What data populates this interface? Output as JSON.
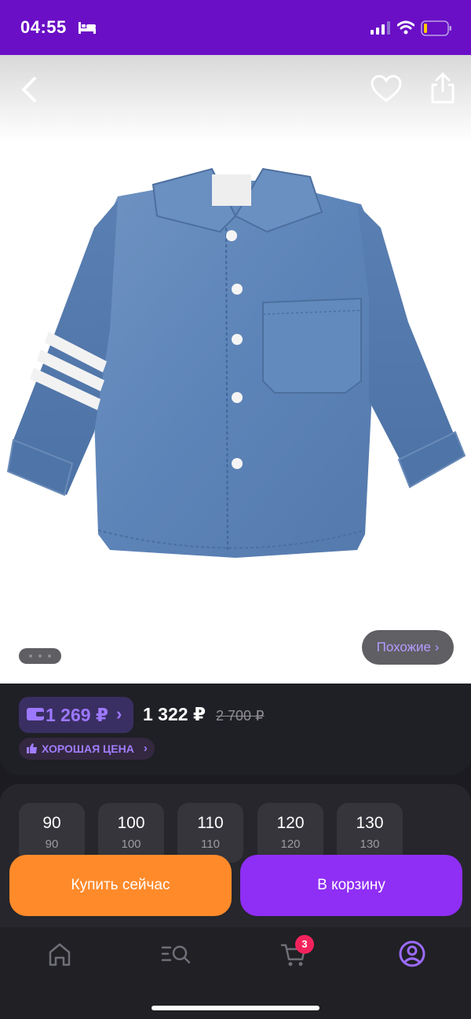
{
  "status_bar": {
    "time": "04:55",
    "icons": [
      "bed-icon",
      "signal-icon",
      "wifi-icon",
      "battery-icon"
    ],
    "background_color": "#6a0fc6"
  },
  "product_gallery": {
    "image": "denim-shirt-image",
    "actions": [
      "back-icon",
      "heart-icon",
      "share-icon"
    ],
    "similar_button": "Похожие ›",
    "pager_dots": 3
  },
  "pricing": {
    "wallet_price": "1 269 ₽",
    "wallet_chevron": "›",
    "regular_price": "1 322 ₽",
    "old_price": "2 700 ₽",
    "badge": "ХОРОШАЯ ЦЕНА",
    "badge_chevron": "›",
    "accent_color": "#9c78ff"
  },
  "sizes": [
    {
      "label": "90",
      "sub": "90"
    },
    {
      "label": "100",
      "sub": "100"
    },
    {
      "label": "110",
      "sub": "110"
    },
    {
      "label": "120",
      "sub": "120"
    },
    {
      "label": "130",
      "sub": "130"
    }
  ],
  "actions": {
    "buy_now": "Купить сейчас",
    "add_to_cart": "В корзину",
    "buy_color": "#ff8a2a",
    "cart_color": "#8f2ef5"
  },
  "bottom_nav": {
    "items": [
      "home-icon",
      "catalog-search-icon",
      "cart-icon",
      "profile-icon"
    ],
    "cart_count": "3",
    "active": "profile-icon"
  }
}
